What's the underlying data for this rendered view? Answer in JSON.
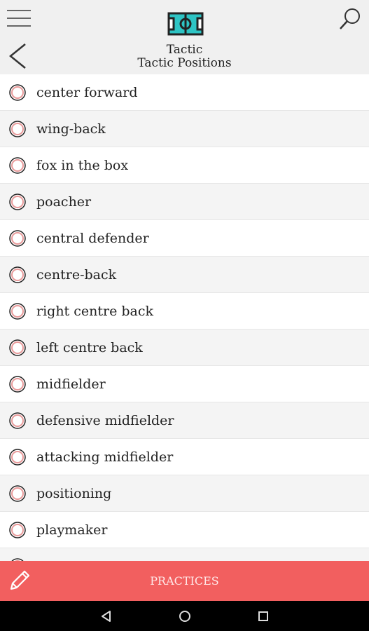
{
  "header": {
    "title": "Tactic",
    "subtitle": "Tactic Positions",
    "icons": [
      "menu-icon",
      "search-icon",
      "back-icon",
      "soccer-field-icon"
    ]
  },
  "positions": [
    {
      "label": "center forward"
    },
    {
      "label": "wing-back"
    },
    {
      "label": "fox in the box"
    },
    {
      "label": "poacher"
    },
    {
      "label": "central defender"
    },
    {
      "label": "centre-back"
    },
    {
      "label": "right centre back"
    },
    {
      "label": "left centre back"
    },
    {
      "label": "midfielder"
    },
    {
      "label": "defensive midfielder"
    },
    {
      "label": "attacking midfielder"
    },
    {
      "label": "positioning"
    },
    {
      "label": "playmaker"
    },
    {
      "label": ""
    }
  ],
  "bottom_bar": {
    "button_label": "PRACTICES",
    "icon": "pencil-icon",
    "color": "#f25f5f"
  },
  "system_nav": {
    "icons": [
      "nav-back-icon",
      "nav-home-icon",
      "nav-recents-icon"
    ]
  },
  "colors": {
    "header_bg": "#f0f0f0",
    "row_alt_bg": "#f4f4f4",
    "radio_ring": "#e89a9a"
  }
}
